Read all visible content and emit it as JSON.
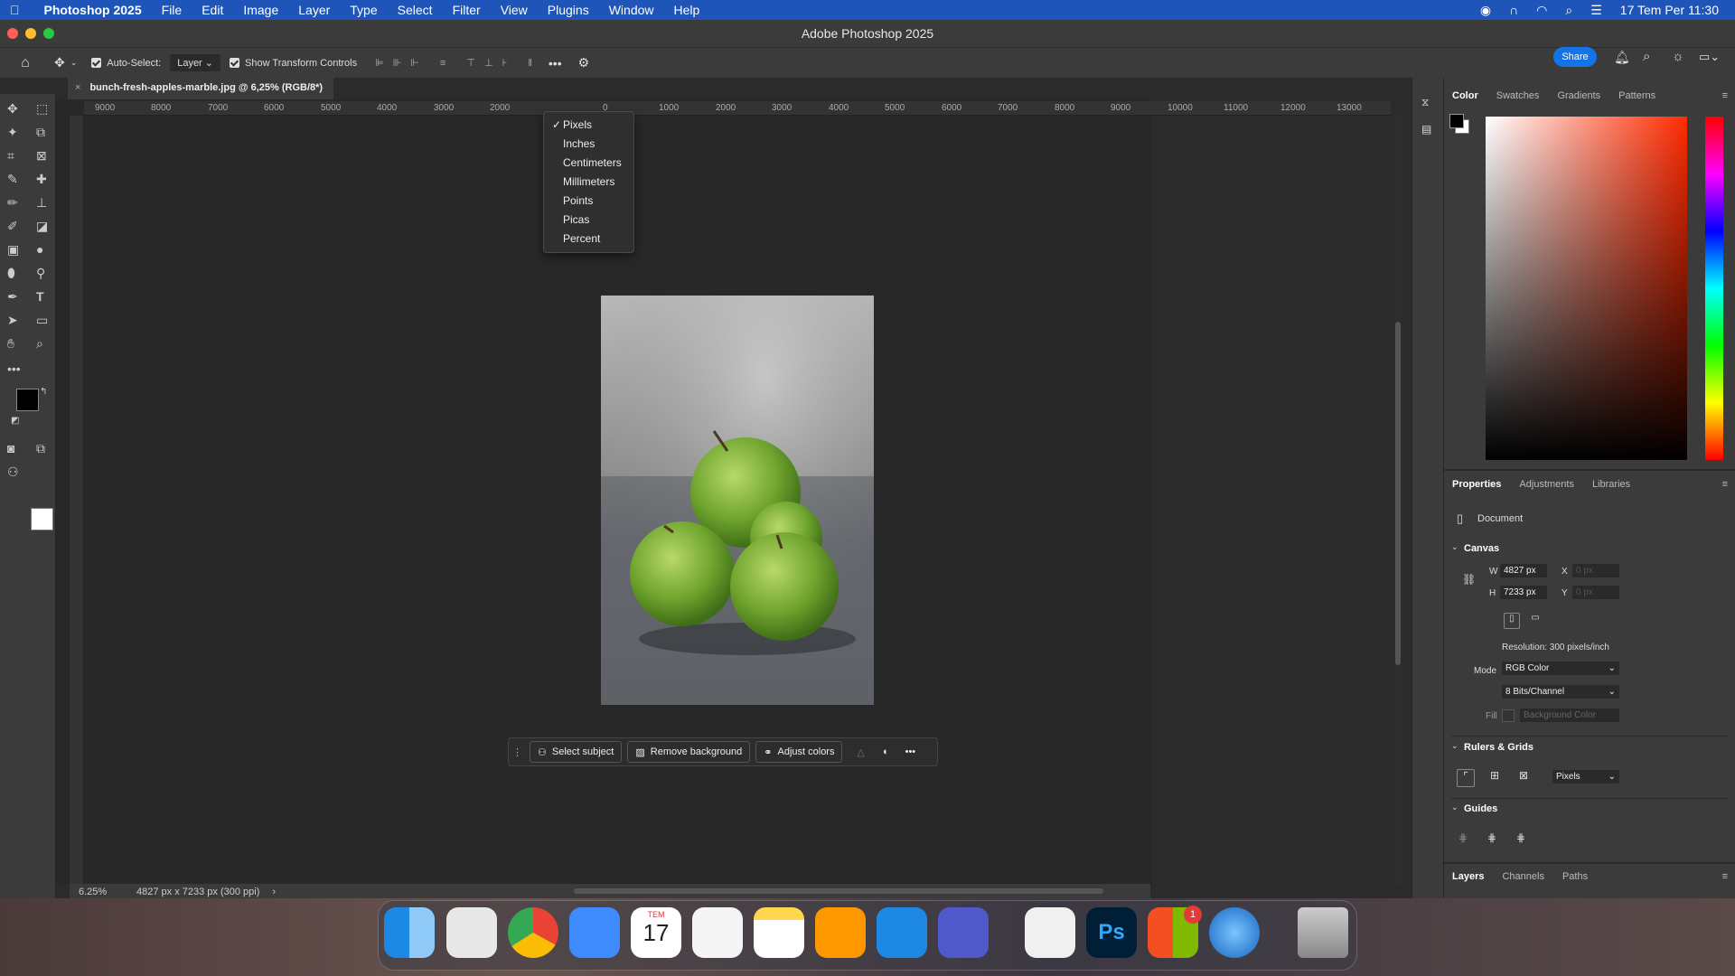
{
  "menubar": {
    "app": "Photoshop 2025",
    "items": [
      "File",
      "Edit",
      "Image",
      "Layer",
      "Type",
      "Select",
      "Filter",
      "View",
      "Plugins",
      "Window",
      "Help"
    ],
    "clock": "17 Tem Per  11:30"
  },
  "window": {
    "title": "Adobe Photoshop 2025"
  },
  "options": {
    "auto_select": "Auto-Select:",
    "target": "Layer",
    "transform": "Show Transform Controls",
    "share": "Share"
  },
  "document": {
    "tab": "bunch-fresh-apples-marble.jpg @ 6,25% (RGB/8*)",
    "zoom": "6.25%",
    "info": "4827 px x 7233 px (300 ppi)"
  },
  "ruler": {
    "labels_left": [
      "9000",
      "8000",
      "7000",
      "6000",
      "5000",
      "4000",
      "3000",
      "2000"
    ],
    "labels_right": [
      "0",
      "1000",
      "2000",
      "3000",
      "4000",
      "5000",
      "6000",
      "7000",
      "8000",
      "9000",
      "10000",
      "11000",
      "12000",
      "13000"
    ]
  },
  "ruler_menu": {
    "selected": "Pixels",
    "items": [
      "Pixels",
      "Inches",
      "Centimeters",
      "Millimeters",
      "Points",
      "Picas",
      "Percent"
    ]
  },
  "taskbar": {
    "select_subject": "Select subject",
    "remove_bg": "Remove background",
    "adjust": "Adjust colors"
  },
  "color_panel": {
    "tabs": [
      "Color",
      "Swatches",
      "Gradients",
      "Patterns"
    ],
    "fg": "#000000",
    "bg": "#ffffff",
    "hue": "#ff2a00"
  },
  "properties": {
    "tabs": [
      "Properties",
      "Adjustments",
      "Libraries"
    ],
    "doc_label": "Document",
    "canvas_title": "Canvas",
    "w_label": "W",
    "w": "4827 px",
    "h_label": "H",
    "h": "7233 px",
    "x_label": "X",
    "x": "0 px",
    "y_label": "Y",
    "y": "0 px",
    "resolution": "Resolution: 300 pixels/inch",
    "mode_label": "Mode",
    "mode": "RGB Color",
    "bits": "8 Bits/Channel",
    "fill_label": "Fill",
    "fill": "Background Color",
    "rulers_title": "Rulers & Grids",
    "ruler_unit": "Pixels",
    "guides_title": "Guides"
  },
  "layers": {
    "tabs": [
      "Layers",
      "Channels",
      "Paths"
    ]
  },
  "dock": {
    "calendar_month": "TEM",
    "calendar_day": "17",
    "badge": "1"
  }
}
